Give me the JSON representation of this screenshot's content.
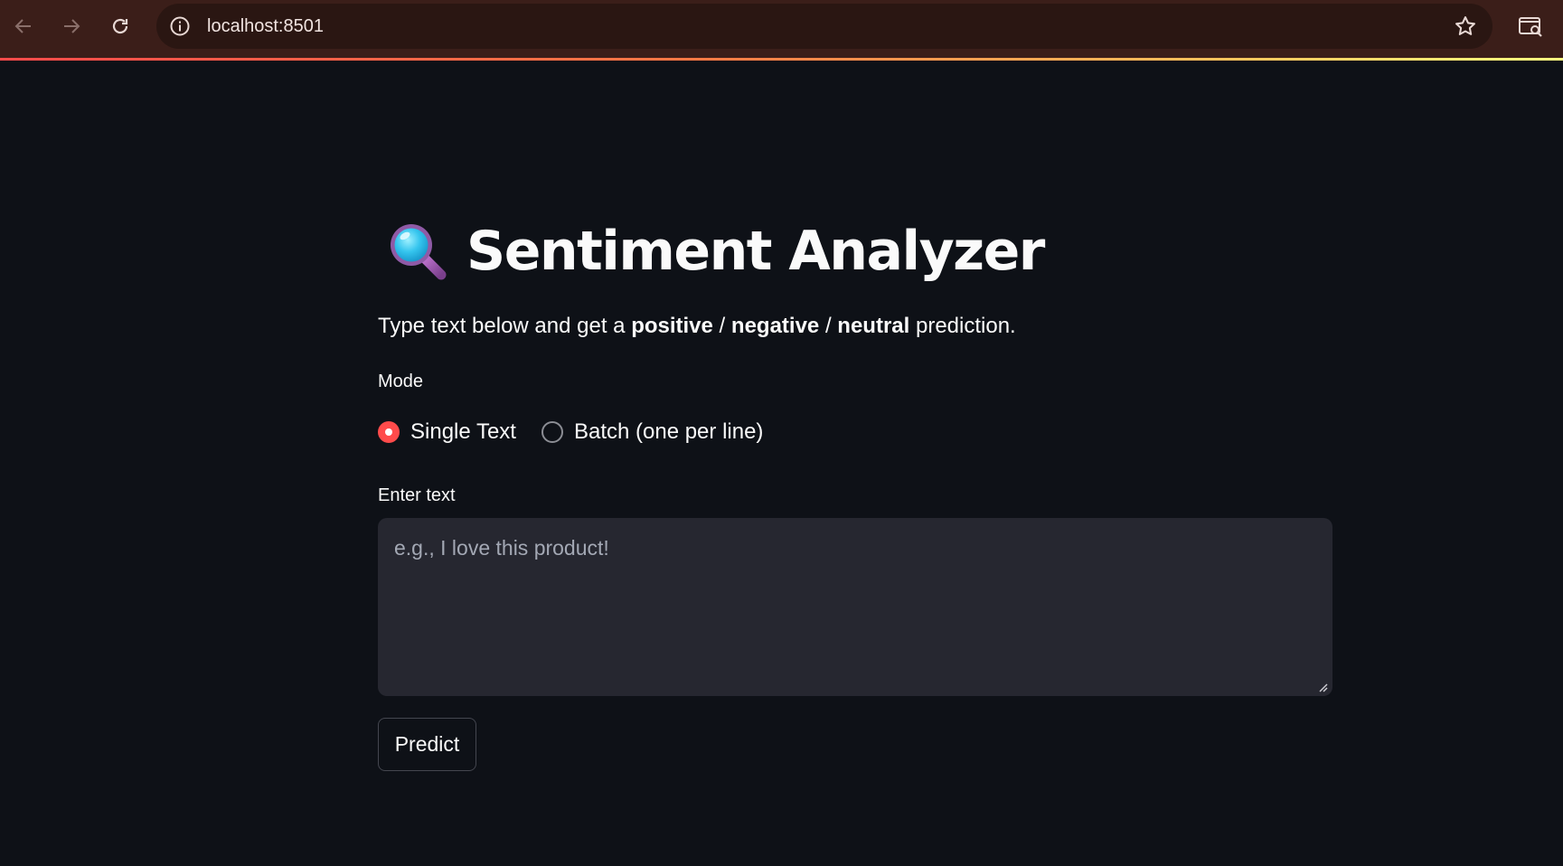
{
  "browser": {
    "url": "localhost:8501",
    "icons": {
      "back": "arrow-left-icon",
      "forward": "arrow-right-icon",
      "reload": "reload-icon",
      "site_info": "info-icon",
      "bookmark": "star-icon",
      "side_panel": "side-panel-search-icon"
    }
  },
  "app": {
    "title_icon": "magnifying-glass-icon",
    "title": "Sentiment Analyzer",
    "subtitle": {
      "prefix": "Type text below and get a ",
      "positive": "positive",
      "sep1": " / ",
      "negative": "negative",
      "sep2": " / ",
      "neutral": "neutral",
      "suffix": " prediction."
    },
    "mode": {
      "label": "Mode",
      "options": [
        "Single Text",
        "Batch (one per line)"
      ],
      "selected": "Single Text"
    },
    "input": {
      "label": "Enter text",
      "placeholder": "e.g., I love this product!",
      "value": ""
    },
    "predict_button": "Predict"
  },
  "colors": {
    "background": "#0e1117",
    "chrome": "#3b1e19",
    "accent": "#ff4b4b",
    "input_bg": "#262730",
    "text": "#fafafa"
  }
}
